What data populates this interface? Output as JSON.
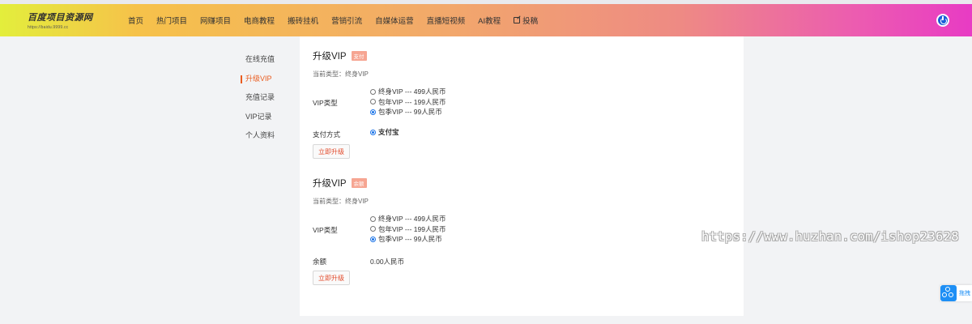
{
  "header": {
    "logo_text": "百度项目资源网",
    "logo_url": "https://baidu.9999.cc",
    "nav": [
      "首页",
      "热门项目",
      "网赚项目",
      "电商教程",
      "搬砖挂机",
      "营销引流",
      "自媒体运营",
      "直播短视频",
      "AI教程",
      "投稿"
    ],
    "power_icon": "power-icon"
  },
  "sidebar": {
    "items": [
      {
        "label": "在线充值",
        "active": false
      },
      {
        "label": "升级VIP",
        "active": true
      },
      {
        "label": "充值记录",
        "active": false
      },
      {
        "label": "VIP记录",
        "active": false
      },
      {
        "label": "个人资料",
        "active": false
      }
    ]
  },
  "sections": [
    {
      "title": "升级VIP",
      "badge": "支付",
      "current_type": "当前类型：终身VIP",
      "vip_label": "VIP类型",
      "options": [
        {
          "label": "终身VIP --- 499人民币",
          "checked": false
        },
        {
          "label": "包年VIP --- 199人民币",
          "checked": false
        },
        {
          "label": "包季VIP --- 99人民币",
          "checked": true
        }
      ],
      "pay_label": "支付方式",
      "pay_value": "支付宝",
      "button": "立即升级"
    },
    {
      "title": "升级VIP",
      "badge": "余额",
      "current_type": "当前类型：终身VIP",
      "vip_label": "VIP类型",
      "options": [
        {
          "label": "终身VIP --- 499人民币",
          "checked": false
        },
        {
          "label": "包年VIP --- 199人民币",
          "checked": false
        },
        {
          "label": "包季VIP --- 99人民币",
          "checked": true
        }
      ],
      "balance_label": "余额",
      "balance_value": "0.00人民币",
      "button": "立即升级"
    }
  ],
  "watermark": "https://www.huzhan.com/ishop23628",
  "float": {
    "label": "拖拽"
  },
  "colors": {
    "accent": "#ea5c1f",
    "radio": "#1a73e8",
    "badge": "#f6a592"
  }
}
